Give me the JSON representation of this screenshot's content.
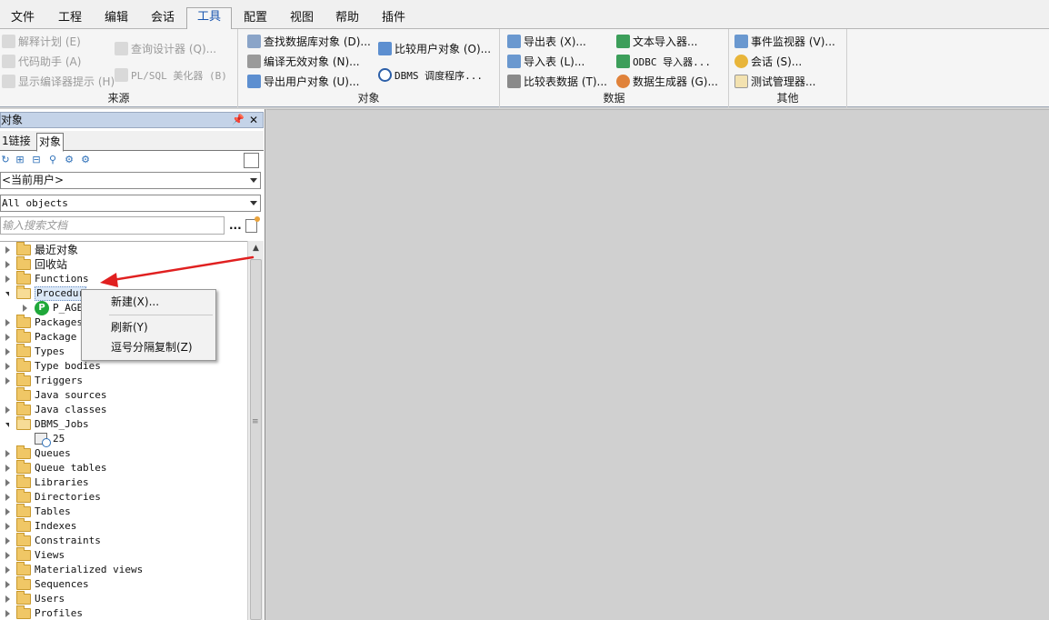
{
  "menubar": {
    "tabs": [
      {
        "label": "文件"
      },
      {
        "label": "工程"
      },
      {
        "label": "编辑"
      },
      {
        "label": "会话"
      },
      {
        "label": "工具",
        "active": true
      },
      {
        "label": "配置"
      },
      {
        "label": "视图"
      },
      {
        "label": "帮助"
      },
      {
        "label": "插件"
      }
    ]
  },
  "ribbon": {
    "groups": [
      {
        "label": "来源",
        "items": [
          {
            "label": "解释计划 (E)",
            "icon": "explain-plan-icon",
            "enabled": false
          },
          {
            "label": "代码助手 (A)",
            "icon": "code-assistant-icon",
            "enabled": false
          },
          {
            "label": "显示编译器提示 (H)",
            "icon": "compiler-hints-icon",
            "enabled": false
          },
          {
            "label": "查询设计器 (Q)...",
            "icon": "query-designer-icon",
            "enabled": false
          },
          {
            "label": "PL/SQL 美化器 (B)",
            "icon": "beautifier-icon",
            "enabled": false
          }
        ]
      },
      {
        "label": "对象",
        "items": [
          {
            "label": "查找数据库对象 (D)...",
            "icon": "find-db-objects-icon"
          },
          {
            "label": "编译无效对象 (N)...",
            "icon": "compile-invalid-icon"
          },
          {
            "label": "导出用户对象 (U)...",
            "icon": "export-user-objects-icon"
          },
          {
            "label": "比较用户对象 (O)...",
            "icon": "compare-user-objects-icon"
          },
          {
            "label": "DBMS 调度程序...",
            "icon": "dbms-scheduler-icon"
          }
        ]
      },
      {
        "label": "数据",
        "items": [
          {
            "label": "导出表 (X)...",
            "icon": "export-tables-icon"
          },
          {
            "label": "导入表 (L)...",
            "icon": "import-tables-icon"
          },
          {
            "label": "比较表数据 (T)...",
            "icon": "compare-table-data-icon"
          },
          {
            "label": "文本导入器...",
            "icon": "text-importer-icon"
          },
          {
            "label": "ODBC 导入器...",
            "icon": "odbc-importer-icon"
          },
          {
            "label": "数据生成器 (G)...",
            "icon": "data-generator-icon"
          }
        ]
      },
      {
        "label": "其他",
        "items": [
          {
            "label": "事件监视器 (V)...",
            "icon": "event-monitor-icon"
          },
          {
            "label": "会话 (S)...",
            "icon": "sessions-icon"
          },
          {
            "label": "测试管理器...",
            "icon": "test-manager-icon"
          }
        ]
      }
    ]
  },
  "panel": {
    "title": "对象",
    "tabs": [
      {
        "label": "1链接"
      },
      {
        "label": "对象"
      }
    ],
    "user_combo": "<当前用户>",
    "filter_combo": "All objects",
    "search_placeholder": "输入搜索文档",
    "search_button": "...",
    "toolbar_icons": [
      "refresh-icon",
      "expand-icon",
      "collapse-icon",
      "find-icon",
      "filter-icon",
      "filter-edit-icon"
    ]
  },
  "tree": {
    "nodes": [
      {
        "label": "最近对象",
        "cjk": true
      },
      {
        "label": "回收站",
        "cjk": true
      },
      {
        "label": "Functions"
      },
      {
        "label": "Procedur",
        "open": true,
        "selected": true
      },
      {
        "label": "P_AGE",
        "child": true,
        "type": "procedure"
      },
      {
        "label": "Packages"
      },
      {
        "label": "Package bodies"
      },
      {
        "label": "Types"
      },
      {
        "label": "Type bodies"
      },
      {
        "label": "Triggers"
      },
      {
        "label": "Java sources",
        "noexpand": true
      },
      {
        "label": "Java classes"
      },
      {
        "label": "DBMS_Jobs",
        "open": true
      },
      {
        "label": "25",
        "child": true,
        "type": "job"
      },
      {
        "label": "Queues"
      },
      {
        "label": "Queue tables"
      },
      {
        "label": "Libraries"
      },
      {
        "label": "Directories"
      },
      {
        "label": "Tables"
      },
      {
        "label": "Indexes"
      },
      {
        "label": "Constraints"
      },
      {
        "label": "Views"
      },
      {
        "label": "Materialized views"
      },
      {
        "label": "Sequences"
      },
      {
        "label": "Users"
      },
      {
        "label": "Profiles"
      }
    ]
  },
  "context_menu": {
    "items": [
      {
        "label": "新建(X)..."
      },
      {
        "label": "刷新(Y)"
      },
      {
        "label": "逗号分隔复制(Z)"
      }
    ]
  },
  "colors": {
    "annotation_arrow": "#e02020",
    "procedure_badge": "#1fa83a",
    "folder": "#f0c766"
  }
}
